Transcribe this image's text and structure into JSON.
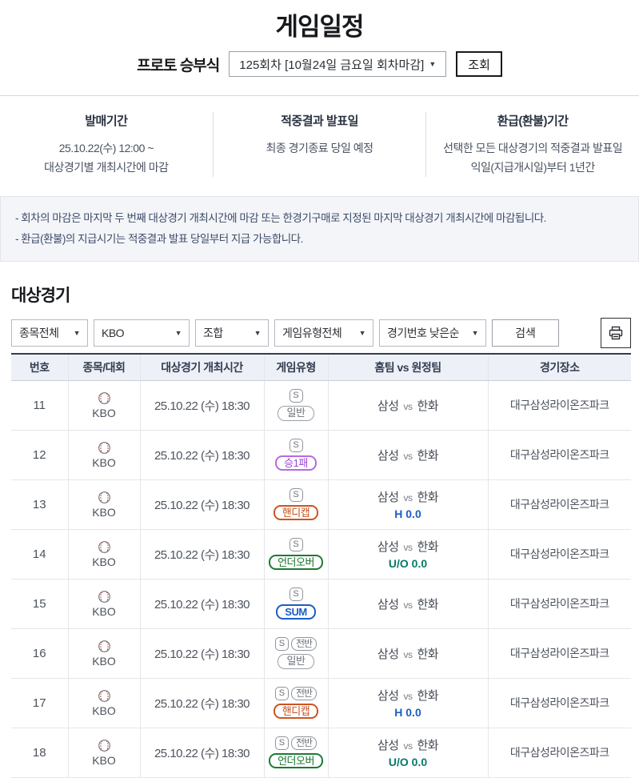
{
  "page": {
    "title": "게임일정",
    "round_label": "프로토 승부식",
    "round_value": "125회차 [10월24일 금요일 회차마감]",
    "inquiry_button": "조회",
    "caret": "▼"
  },
  "info_columns": [
    {
      "title": "발매기간",
      "line1": "25.10.22(수) 12:00 ~",
      "line2": "대상경기별 개최시간에 마감"
    },
    {
      "title": "적중결과 발표일",
      "line1": "최종 경기종료 당일 예정",
      "line2": ""
    },
    {
      "title": "환급(환불)기간",
      "line1": "선택한 모든 대상경기의 적중결과 발표일",
      "line2": "익일(지급개시일)부터 1년간"
    }
  ],
  "notes": {
    "line1": "- 회차의 마감은 마지막 두 번째 대상경기 개최시간에 마감 또는 한경기구매로 지정된 마지막 대상경기 개최시간에 마감됩니다.",
    "line2": "- 환급(환불)의 지급시기는 적중결과 발표 당일부터 지급 가능합니다."
  },
  "section_title": "대상경기",
  "filters": {
    "sport": "종목전체",
    "league": "KBO",
    "combo": "조합",
    "game_type": "게임유형전체",
    "sort": "경기번호 낮은순",
    "search_button": "검색",
    "print_icon": "printer-icon"
  },
  "colors": {
    "accent_navy": "#333d52",
    "badge_purple": "#9a46d8",
    "badge_orange": "#c3511d",
    "badge_green": "#1a7330",
    "badge_blue": "#1b5ec4",
    "line_blue": "#1b5ec4",
    "line_teal": "#067a68"
  },
  "table": {
    "headers": [
      "번호",
      "종목/대회",
      "대상경기 개최시간",
      "게임유형",
      "홈팀 vs 원정팀",
      "경기장소"
    ],
    "vs_label": "vs",
    "rows": [
      {
        "no": "11",
        "league": "KBO",
        "time": "25.10.22 (수) 18:30",
        "s": "S",
        "half": "",
        "half_class": "hidden",
        "type": "일반",
        "type_class": "tbadge t-gray",
        "home": "삼성",
        "away": "한화",
        "line": "",
        "line_class": "hidden",
        "venue": "대구삼성라이온즈파크"
      },
      {
        "no": "12",
        "league": "KBO",
        "time": "25.10.22 (수) 18:30",
        "s": "S",
        "half": "",
        "half_class": "hidden",
        "type": "승1패",
        "type_class": "tbadge t-purple",
        "home": "삼성",
        "away": "한화",
        "line": "",
        "line_class": "hidden",
        "venue": "대구삼성라이온즈파크"
      },
      {
        "no": "13",
        "league": "KBO",
        "time": "25.10.22 (수) 18:30",
        "s": "S",
        "half": "",
        "half_class": "hidden",
        "type": "핸디캡",
        "type_class": "tbadge t-orange",
        "home": "삼성",
        "away": "한화",
        "line": "H 0.0",
        "line_class": "match-line c-blue",
        "venue": "대구삼성라이온즈파크"
      },
      {
        "no": "14",
        "league": "KBO",
        "time": "25.10.22 (수) 18:30",
        "s": "S",
        "half": "",
        "half_class": "hidden",
        "type": "언더오버",
        "type_class": "tbadge t-green",
        "home": "삼성",
        "away": "한화",
        "line": "U/O 0.0",
        "line_class": "match-line c-teal",
        "venue": "대구삼성라이온즈파크"
      },
      {
        "no": "15",
        "league": "KBO",
        "time": "25.10.22 (수) 18:30",
        "s": "S",
        "half": "",
        "half_class": "hidden",
        "type": "SUM",
        "type_class": "tbadge t-blue",
        "home": "삼성",
        "away": "한화",
        "line": "",
        "line_class": "hidden",
        "venue": "대구삼성라이온즈파크"
      },
      {
        "no": "16",
        "league": "KBO",
        "time": "25.10.22 (수) 18:30",
        "s": "S",
        "half": "전반",
        "half_class": "sbadge pill",
        "type": "일반",
        "type_class": "tbadge t-gray",
        "home": "삼성",
        "away": "한화",
        "line": "",
        "line_class": "hidden",
        "venue": "대구삼성라이온즈파크"
      },
      {
        "no": "17",
        "league": "KBO",
        "time": "25.10.22 (수) 18:30",
        "s": "S",
        "half": "전반",
        "half_class": "sbadge pill",
        "type": "핸디캡",
        "type_class": "tbadge t-orange",
        "home": "삼성",
        "away": "한화",
        "line": "H 0.0",
        "line_class": "match-line c-blue",
        "venue": "대구삼성라이온즈파크"
      },
      {
        "no": "18",
        "league": "KBO",
        "time": "25.10.22 (수) 18:30",
        "s": "S",
        "half": "전반",
        "half_class": "sbadge pill",
        "type": "언더오버",
        "type_class": "tbadge t-green",
        "home": "삼성",
        "away": "한화",
        "line": "U/O 0.0",
        "line_class": "match-line c-teal",
        "venue": "대구삼성라이온즈파크"
      }
    ]
  }
}
